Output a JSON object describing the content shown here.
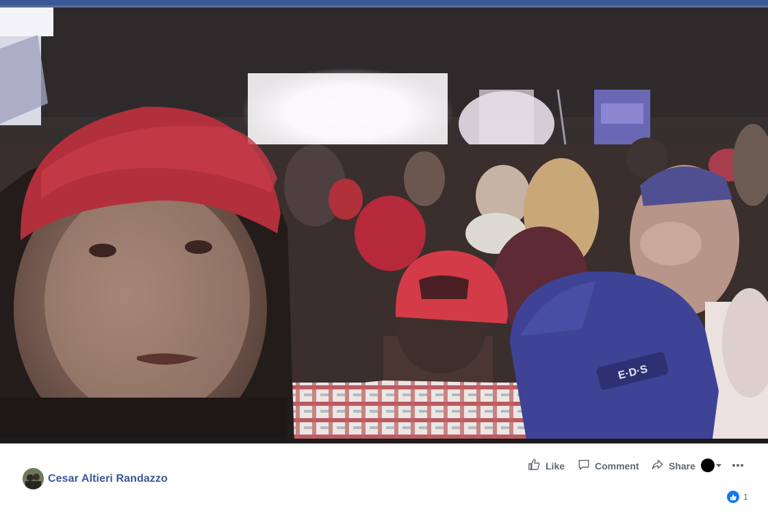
{
  "post": {
    "author": "Cesar Altieri Randazzo",
    "reaction_count": "1",
    "cap_print": "E·D·S"
  },
  "actions": {
    "like": "Like",
    "comment": "Comment",
    "share": "Share"
  },
  "icons": {
    "like": "thumbs-up-icon",
    "comment": "speech-bubble-icon",
    "share": "share-arrow-icon",
    "more": "more-options-icon",
    "reaction": "like-reaction-icon"
  },
  "colors": {
    "accent": "#3b5998",
    "author_link": "#385898",
    "action_text": "#606770",
    "like_reaction": "#1877f2"
  }
}
